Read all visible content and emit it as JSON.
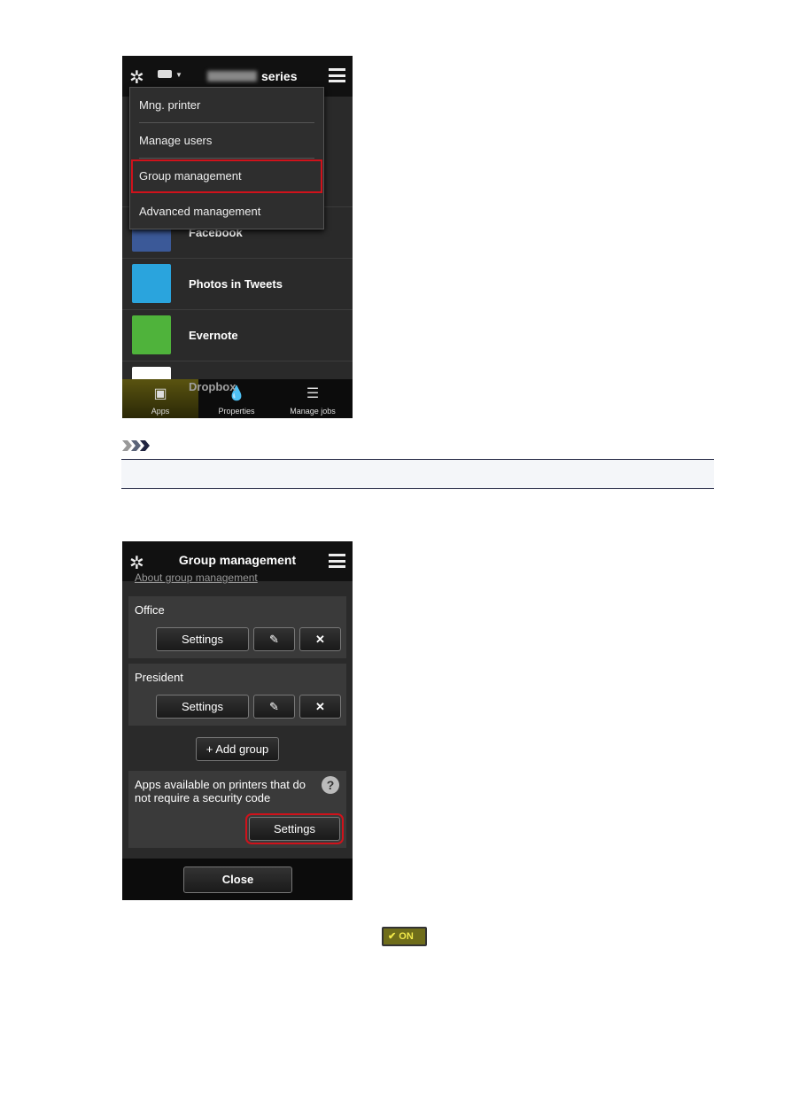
{
  "screen1": {
    "header_suffix": "series",
    "menu": [
      {
        "label": "Mng. printer"
      },
      {
        "label": "Manage users"
      },
      {
        "label": "Group management",
        "highlighted": true
      },
      {
        "label": "Advanced management"
      }
    ],
    "apps": [
      {
        "name": "Facebook",
        "color": "#3b5998"
      },
      {
        "name": "Photos in Tweets",
        "color": "#2aa4dd"
      },
      {
        "name": "Evernote",
        "color": "#4fb33b"
      },
      {
        "name": "Dropbox",
        "color": "#ffffff"
      }
    ],
    "tabs": [
      {
        "label": "Apps",
        "active": true
      },
      {
        "label": "Properties"
      },
      {
        "label": "Manage jobs"
      }
    ]
  },
  "screen2": {
    "title": "Group management",
    "about_link": "About group management",
    "groups": [
      {
        "name": "Office",
        "settings": "Settings"
      },
      {
        "name": "President",
        "settings": "Settings"
      }
    ],
    "add_group": "Add group",
    "apps_no_code": "Apps available on printers that do not require a security code",
    "apps_settings": "Settings",
    "close": "Close"
  },
  "on_badge": "ON",
  "colors": {
    "highlight": "#d0121b",
    "on_badge": "#6f6d1a"
  }
}
